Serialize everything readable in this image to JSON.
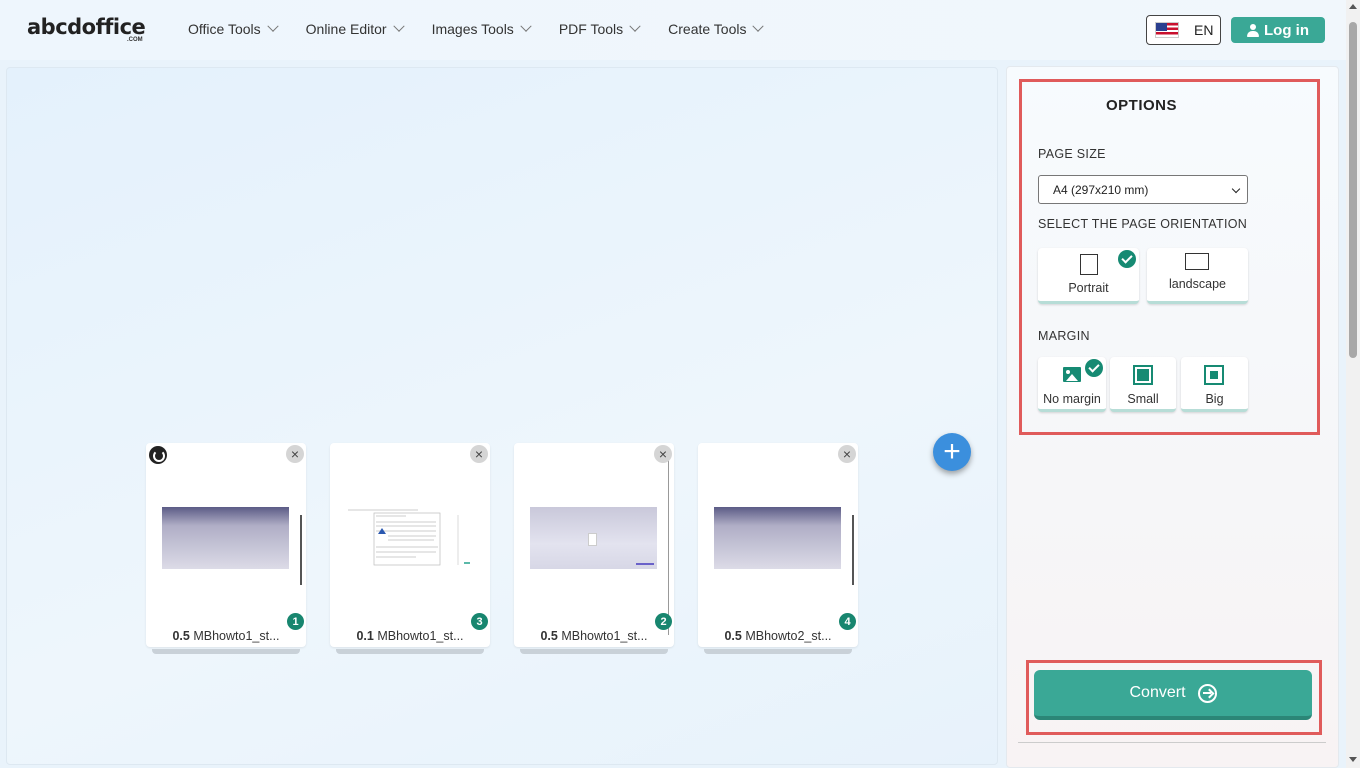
{
  "header": {
    "logo_text": "abcdoffice",
    "logo_suffix": ".COM",
    "nav": [
      {
        "label": "Office Tools"
      },
      {
        "label": "Online Editor"
      },
      {
        "label": "Images Tools"
      },
      {
        "label": "PDF Tools"
      },
      {
        "label": "Create Tools"
      }
    ],
    "language": "EN",
    "login_label": "Log in"
  },
  "files": [
    {
      "size": "0.5",
      "name": "MBhowto1_st...",
      "order": "1"
    },
    {
      "size": "0.1",
      "name": "MBhowto1_st...",
      "order": "3"
    },
    {
      "size": "0.5",
      "name": "MBhowto1_st...",
      "order": "2"
    },
    {
      "size": "0.5",
      "name": "MBhowto2_st...",
      "order": "4"
    }
  ],
  "add_button_icon": "plus-icon",
  "options": {
    "title": "OPTIONS",
    "page_size_label": "PAGE SIZE",
    "page_size_value": "A4 (297x210 mm)",
    "orientation_label": "SELECT THE PAGE ORIENTATION",
    "orientations": [
      {
        "label": "Portrait",
        "selected": true
      },
      {
        "label": "landscape",
        "selected": false
      }
    ],
    "margin_label": "MARGIN",
    "margins": [
      {
        "label": "No margin",
        "selected": true
      },
      {
        "label": "Small",
        "selected": false
      },
      {
        "label": "Big",
        "selected": false
      }
    ],
    "convert_label": "Convert"
  },
  "colors": {
    "accent": "#3aa896",
    "check": "#168a73",
    "highlight": "#e05b5b",
    "add_button": "#3b8fdd"
  }
}
